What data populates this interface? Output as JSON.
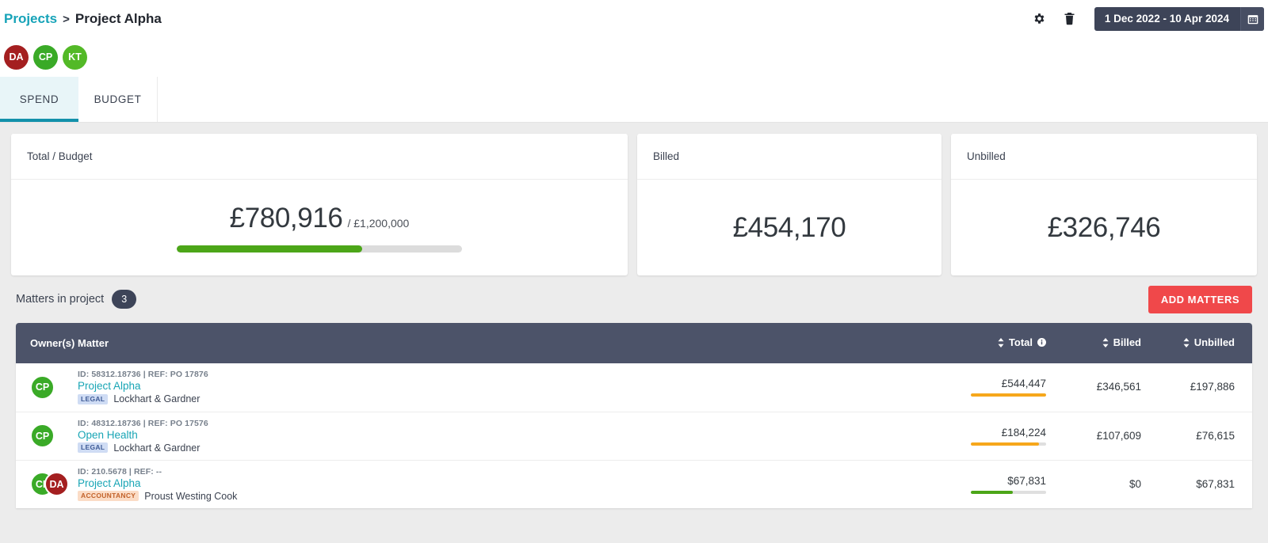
{
  "topbar": {
    "breadcrumb": {
      "root_label": "Projects",
      "separator": ">",
      "current_label": "Project Alpha"
    },
    "settings_icon": "gear-icon",
    "delete_icon": "trash-icon",
    "date_range": "1 Dec 2022 - 10 Apr 2024",
    "calendar_icon": "calendar-icon"
  },
  "project_members": [
    {
      "initials": "DA",
      "color": "#a41f20"
    },
    {
      "initials": "CP",
      "color": "#3aaa27"
    },
    {
      "initials": "KT",
      "color": "#53b927"
    }
  ],
  "tabs": [
    {
      "label": "SPEND",
      "active": true
    },
    {
      "label": "BUDGET",
      "active": false
    }
  ],
  "summary_cards": {
    "total": {
      "title": "Total / Budget",
      "amount": "£780,916",
      "budget": "/ £1,200,000",
      "progress_percent": 65,
      "progress_color": "#4ca618"
    },
    "billed": {
      "title": "Billed",
      "amount": "£454,170"
    },
    "unbilled": {
      "title": "Unbilled",
      "amount": "£326,746"
    }
  },
  "matters_section": {
    "label": "Matters in project",
    "count": "3",
    "add_button_label": "ADD MATTERS",
    "add_button_color": "#f0484a"
  },
  "table": {
    "headers": {
      "owners": "Owner(s)",
      "matter": "Matter",
      "total": "Total",
      "billed": "Billed",
      "unbilled": "Unbilled"
    },
    "rows": [
      {
        "owners": [
          {
            "initials": "CP",
            "color": "#3aaa27"
          }
        ],
        "id_ref": "ID: 58312.18736  |  REF: PO 17876",
        "matter_name": "Project Alpha",
        "tag": "LEGAL",
        "tag_type": "legal",
        "firm": "Lockhart & Gardner",
        "total": "£544,447",
        "total_bar_percent": 100,
        "total_bar_color": "#f6a71b",
        "billed": "£346,561",
        "unbilled": "£197,886"
      },
      {
        "owners": [
          {
            "initials": "CP",
            "color": "#3aaa27"
          }
        ],
        "id_ref": "ID: 48312.18736  |  REF: PO 17576",
        "matter_name": "Open Health",
        "tag": "LEGAL",
        "tag_type": "legal",
        "firm": "Lockhart & Gardner",
        "total": "£184,224",
        "total_bar_percent": 90,
        "total_bar_color": "#f6a71b",
        "billed": "£107,609",
        "unbilled": "£76,615"
      },
      {
        "owners": [
          {
            "initials": "CP",
            "color": "#3aaa27"
          },
          {
            "initials": "DA",
            "color": "#a41f20"
          }
        ],
        "id_ref": "ID: 210.5678  |  REF: --",
        "matter_name": "Project Alpha",
        "tag": "ACCOUNTANCY",
        "tag_type": "accountancy",
        "firm": "Proust Westing Cook",
        "total": "$67,831",
        "total_bar_percent": 56,
        "total_bar_color": "#4ca618",
        "billed": "$0",
        "unbilled": "$67,831"
      }
    ]
  }
}
